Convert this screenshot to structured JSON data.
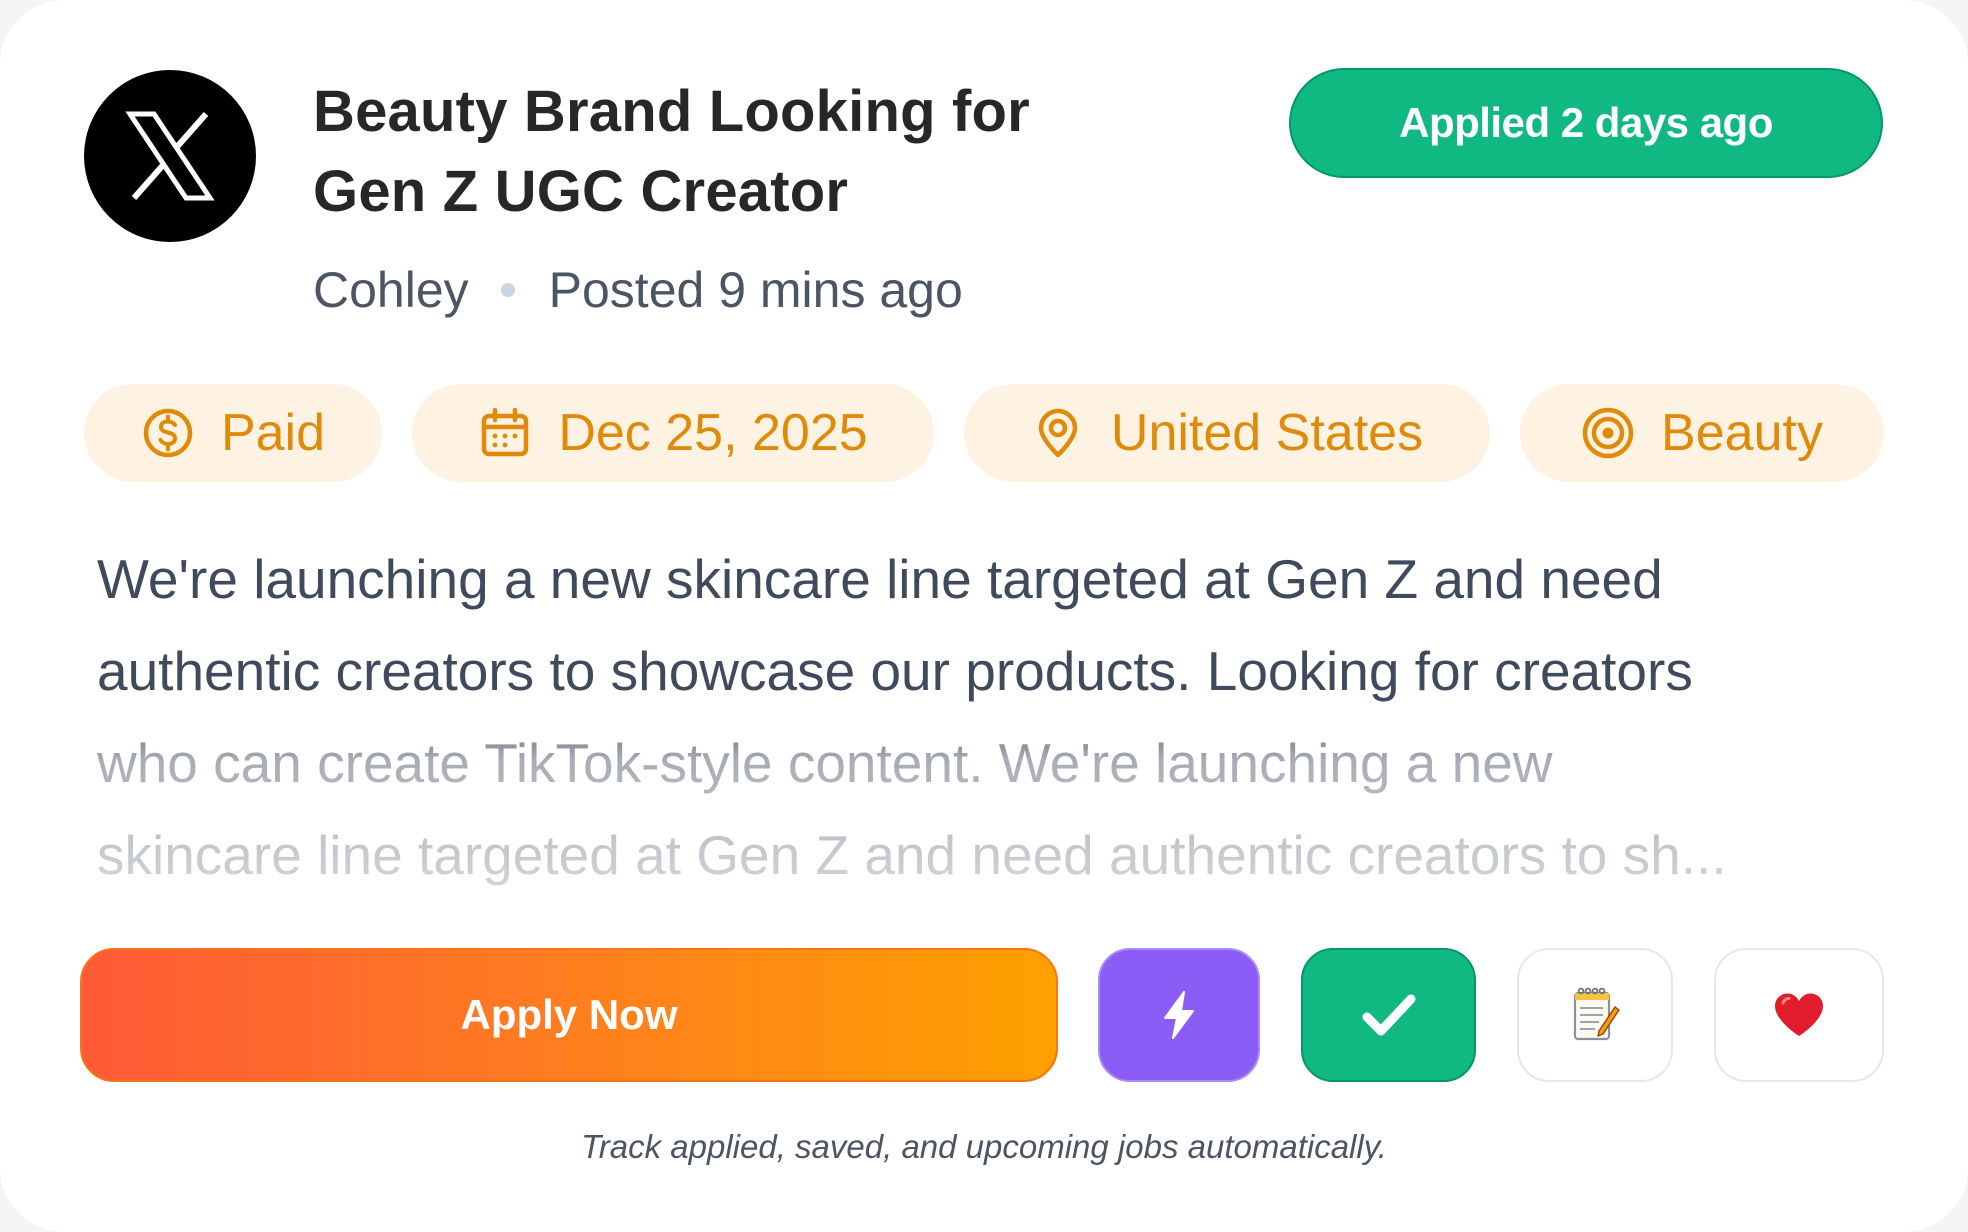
{
  "job": {
    "logo_icon": "x-logo-icon",
    "title_line1": "Beauty Brand Looking for",
    "title_line2": "Gen Z UGC Creator",
    "company": "Cohley",
    "posted": "Posted 9 mins ago",
    "applied_badge": "Applied 2 days ago"
  },
  "chips": {
    "paid": {
      "label": "Paid",
      "icon": "dollar-circle-icon"
    },
    "date": {
      "label": "Dec 25, 2025",
      "icon": "calendar-icon"
    },
    "location": {
      "label": "United States",
      "icon": "map-pin-icon"
    },
    "category": {
      "label": "Beauty",
      "icon": "target-icon"
    }
  },
  "description": {
    "line1": "We're launching a new skincare line targeted at Gen Z and need",
    "line2": "authentic creators to showcase our products. Looking for creators",
    "line3": "who can create TikTok-style content. We're launching a new",
    "line4": "skincare line targeted at Gen Z and need authentic creators to sh..."
  },
  "actions": {
    "apply_label": "Apply Now",
    "boost_icon": "lightning-bolt-icon",
    "applied_icon": "checkmark-icon",
    "notes_icon": "notepad-icon",
    "favorite_icon": "heart-icon"
  },
  "footnote": "Track applied, saved, and upcoming jobs automatically.",
  "colors": {
    "applied_green": "#10b981",
    "chip_bg": "#fef3e2",
    "chip_text": "#e08a0b",
    "boost_purple": "#8b5cf6",
    "apply_gradient_start": "#ff5a36",
    "apply_gradient_end": "#ffa100"
  }
}
